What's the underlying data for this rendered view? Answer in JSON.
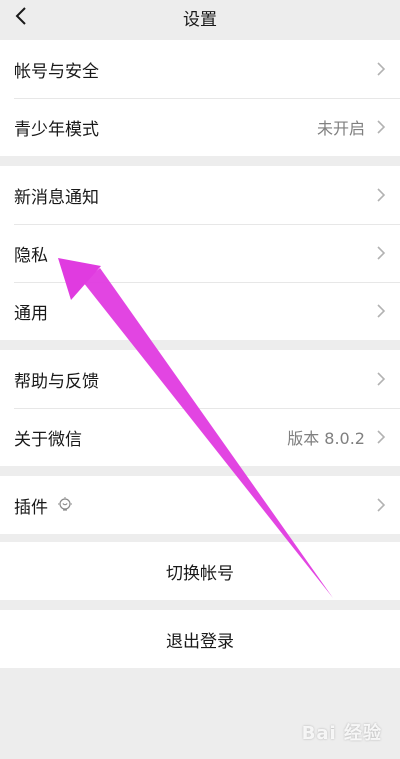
{
  "header": {
    "title": "设置",
    "back_icon": "chevron-left-icon"
  },
  "groups": [
    {
      "items": [
        {
          "label": "帐号与安全",
          "value": ""
        },
        {
          "label": "青少年模式",
          "value": "未开启"
        }
      ]
    },
    {
      "items": [
        {
          "label": "新消息通知",
          "value": ""
        },
        {
          "label": "隐私",
          "value": ""
        },
        {
          "label": "通用",
          "value": ""
        }
      ]
    },
    {
      "items": [
        {
          "label": "帮助与反馈",
          "value": ""
        },
        {
          "label": "关于微信",
          "value": "版本 8.0.2"
        }
      ]
    },
    {
      "items": [
        {
          "label": "插件",
          "value": "",
          "icon": "lightbulb-icon"
        }
      ]
    }
  ],
  "actions": {
    "switch_account": "切换帐号",
    "logout": "退出登录"
  },
  "annotation": {
    "color": "#e03be0"
  },
  "watermark": {
    "text": "Bai 经验"
  }
}
